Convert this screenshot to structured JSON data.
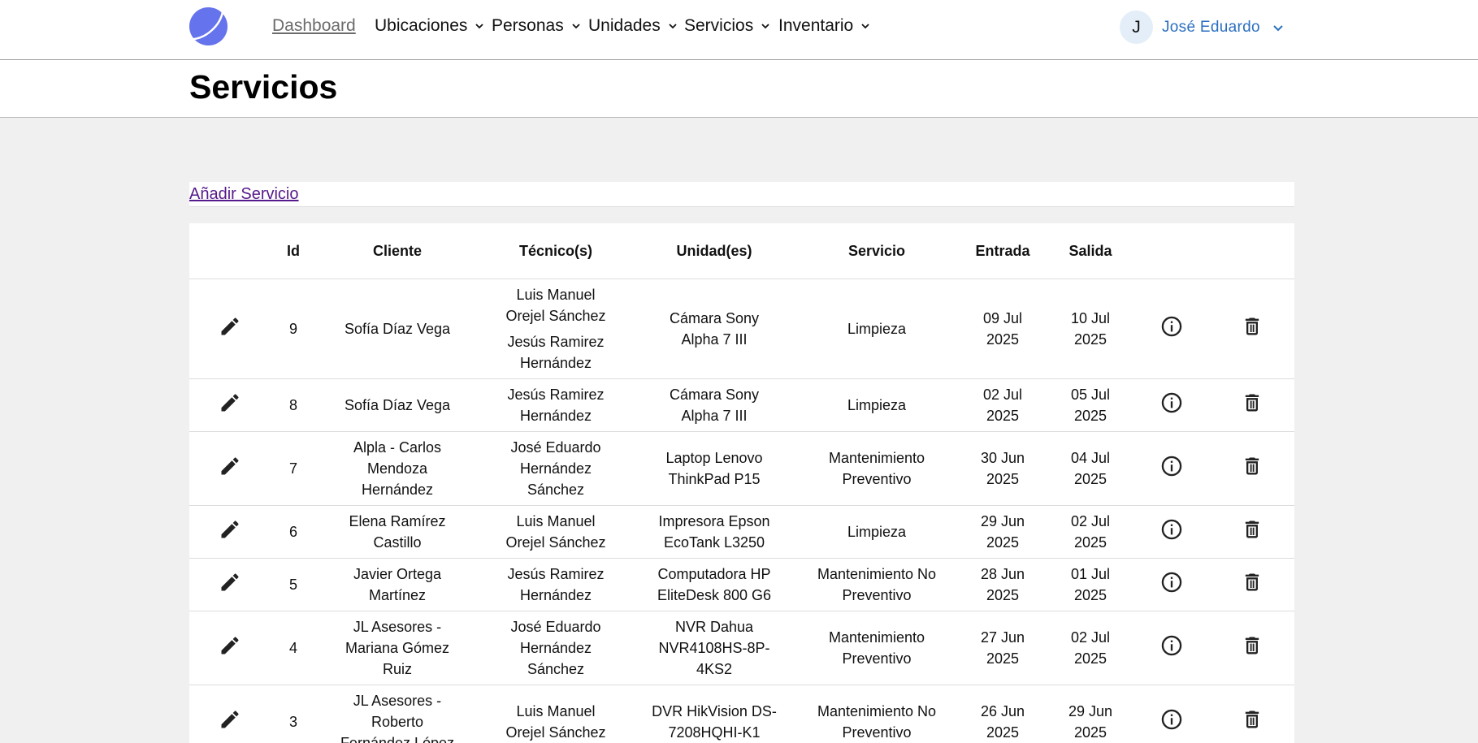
{
  "nav": {
    "dashboard": "Dashboard",
    "menus": [
      "Ubicaciones",
      "Personas",
      "Unidades",
      "Servicios",
      "Inventario"
    ],
    "user": {
      "initial": "J",
      "name": "José Eduardo"
    },
    "logo_color": "#6573ec"
  },
  "page": {
    "title": "Servicios",
    "add_label": "Añadir Servicio"
  },
  "table": {
    "headers": [
      "Id",
      "Cliente",
      "Técnico(s)",
      "Unidad(es)",
      "Servicio",
      "Entrada",
      "Salida"
    ],
    "rows": [
      {
        "id": "9",
        "cliente": "Sofía Díaz Vega",
        "tecnicos": [
          "Luis Manuel Orejel Sánchez",
          "Jesús Ramirez Hernández"
        ],
        "unidad": "Cámara Sony Alpha 7 III",
        "servicio": "Limpieza",
        "entrada": "09 Jul 2025",
        "salida": "10 Jul 2025"
      },
      {
        "id": "8",
        "cliente": "Sofía Díaz Vega",
        "tecnicos": [
          "Jesús Ramirez Hernández"
        ],
        "unidad": "Cámara Sony Alpha 7 III",
        "servicio": "Limpieza",
        "entrada": "02 Jul 2025",
        "salida": "05 Jul 2025"
      },
      {
        "id": "7",
        "cliente": "Alpla - Carlos Mendoza Hernández",
        "tecnicos": [
          "José Eduardo Hernández Sánchez"
        ],
        "unidad": "Laptop Lenovo ThinkPad P15",
        "servicio": "Mantenimiento Preventivo",
        "entrada": "30 Jun 2025",
        "salida": "04 Jul 2025"
      },
      {
        "id": "6",
        "cliente": "Elena Ramírez Castillo",
        "tecnicos": [
          "Luis Manuel Orejel Sánchez"
        ],
        "unidad": "Impresora Epson EcoTank L3250",
        "servicio": "Limpieza",
        "entrada": "29 Jun 2025",
        "salida": "02 Jul 2025"
      },
      {
        "id": "5",
        "cliente": "Javier Ortega Martínez",
        "tecnicos": [
          "Jesús Ramirez Hernández"
        ],
        "unidad": "Computadora HP EliteDesk 800 G6",
        "servicio": "Mantenimiento No Preventivo",
        "entrada": "28 Jun 2025",
        "salida": "01 Jul 2025"
      },
      {
        "id": "4",
        "cliente": "JL Asesores - Mariana Gómez Ruiz",
        "tecnicos": [
          "José Eduardo Hernández Sánchez"
        ],
        "unidad": "NVR Dahua NVR4108HS-8P-4KS2",
        "servicio": "Mantenimiento Preventivo",
        "entrada": "27 Jun 2025",
        "salida": "02 Jul 2025"
      },
      {
        "id": "3",
        "cliente": "JL Asesores - Roberto Fernández López",
        "tecnicos": [
          "Luis Manuel Orejel Sánchez"
        ],
        "unidad": "DVR HikVision DS-7208HQHI-K1",
        "servicio": "Mantenimiento No Preventivo",
        "entrada": "26 Jun 2025",
        "salida": "29 Jun 2025"
      }
    ]
  }
}
